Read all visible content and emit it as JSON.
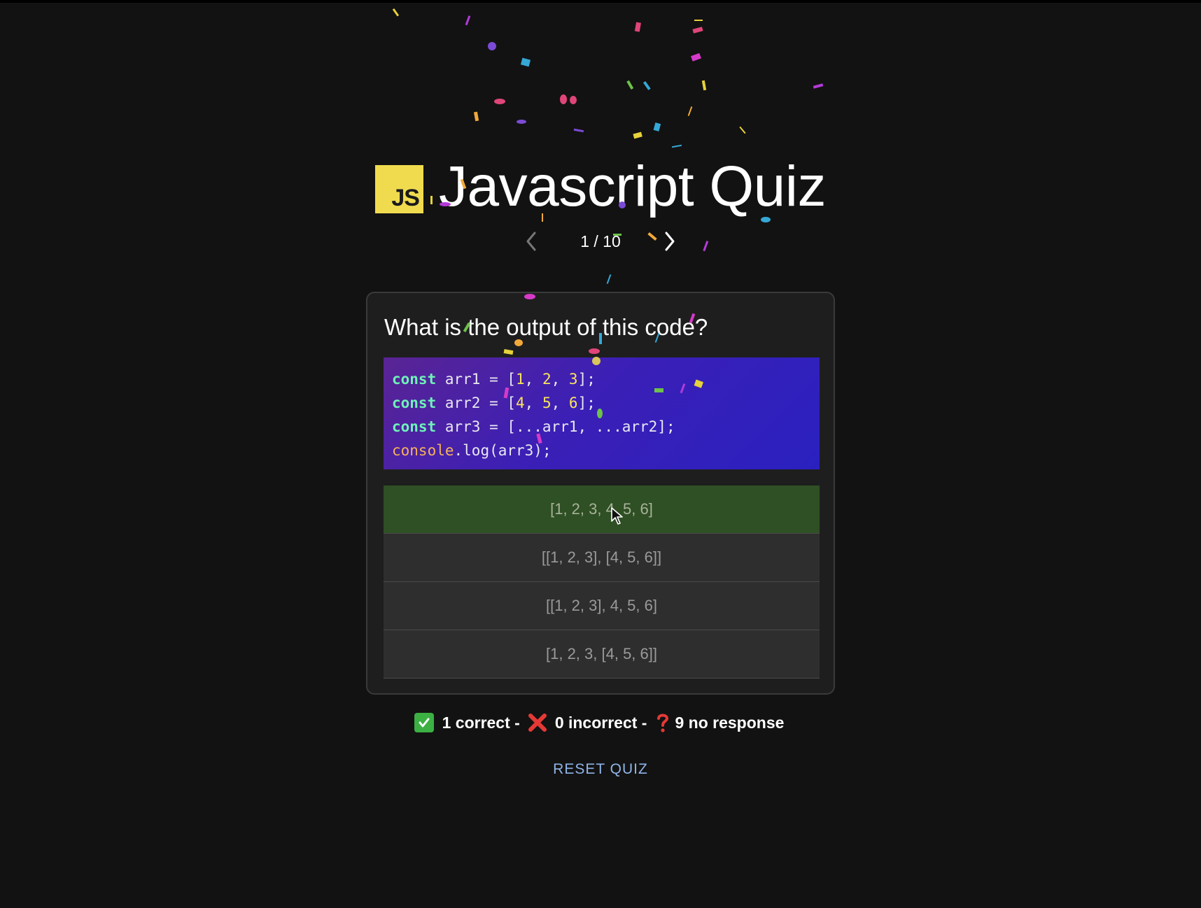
{
  "header": {
    "logo_text": "JS",
    "title": "Javascript Quiz"
  },
  "pager": {
    "current": "1 / 10",
    "prev_icon": "chevron-left-icon",
    "next_icon": "chevron-right-icon"
  },
  "question": {
    "text": "What is the output of this code?",
    "code_lines": [
      "const arr1 = [1, 2, 3];",
      "const arr2 = [4, 5, 6];",
      "const arr3 = [...arr1, ...arr2];",
      "console.log(arr3);"
    ]
  },
  "options": [
    {
      "label": "[1, 2, 3, 4, 5, 6]",
      "state": "correct"
    },
    {
      "label": "[[1, 2, 3], [4, 5, 6]]",
      "state": "default"
    },
    {
      "label": "[[1, 2, 3], 4, 5, 6]",
      "state": "default"
    },
    {
      "label": "[1, 2, 3, [4, 5, 6]]",
      "state": "default"
    }
  ],
  "score": {
    "correct": "1 correct -",
    "incorrect": "0 incorrect -",
    "no_response": "9 no response"
  },
  "reset_label": "RESET QUIZ",
  "colors": {
    "background": "#121212",
    "logo": "#f0db4f",
    "correct_option": "#2f4f24",
    "option": "#2e2e2e",
    "link": "#8fb4e8"
  }
}
